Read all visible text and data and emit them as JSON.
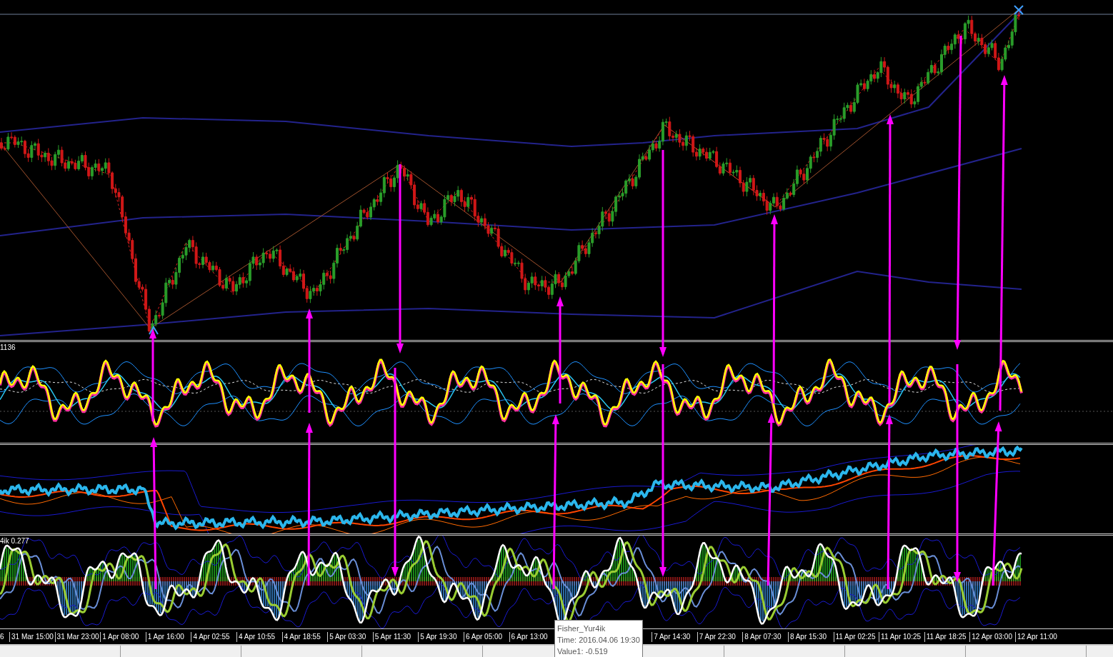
{
  "indicator_pane_1": {
    "label": "1136"
  },
  "indicator_pane_3": {
    "label": "4ik 0.277"
  },
  "time_axis": {
    "labels": [
      "6",
      "31 Mar 15:00",
      "31 Mar 23:00",
      "1 Apr 08:00",
      "1 Apr 16:00",
      "4 Apr 02:55",
      "4 Apr 10:55",
      "4 Apr 18:55",
      "5 Apr 03:30",
      "5 Apr 11:30",
      "5 Apr 19:30",
      "6 Apr 05:00",
      "6 Apr 13:00",
      "7 Apr 14:30",
      "7 Apr 22:30",
      "8 Apr 07:30",
      "8 Apr 15:30",
      "11 Apr 02:25",
      "11 Apr 10:25",
      "11 Apr 18:25",
      "12 Apr 03:00",
      "12 Apr 11:00"
    ]
  },
  "tooltip": {
    "title": "Fisher_Yur4ik",
    "time": "Time: 2016.04.06 19:30",
    "value": "Value1: -0.519"
  }
}
